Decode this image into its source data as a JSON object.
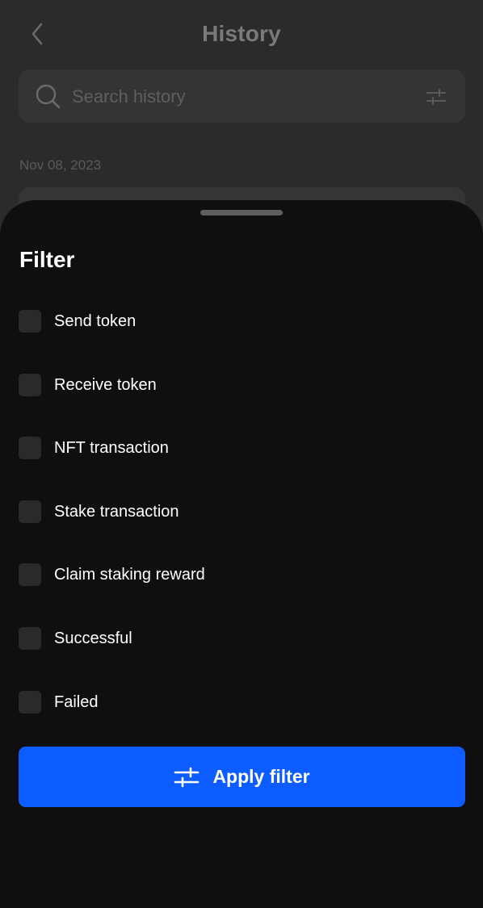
{
  "header": {
    "title": "History",
    "back_icon": "chevron-left-icon"
  },
  "search": {
    "placeholder": "Search history",
    "value": "",
    "search_icon": "search-icon",
    "filter_icon": "sliders-icon"
  },
  "history": {
    "date_group": "Nov 08, 2023"
  },
  "filter_sheet": {
    "title": "Filter",
    "options": [
      {
        "label": "Send token",
        "checked": false
      },
      {
        "label": "Receive token",
        "checked": false
      },
      {
        "label": "NFT transaction",
        "checked": false
      },
      {
        "label": "Stake transaction",
        "checked": false
      },
      {
        "label": "Claim staking reward",
        "checked": false
      },
      {
        "label": "Successful",
        "checked": false
      },
      {
        "label": "Failed",
        "checked": false
      }
    ],
    "apply_label": "Apply filter",
    "apply_icon": "sliders-icon"
  },
  "colors": {
    "accent": "#0c5cff",
    "sheet_background": "#0f0f10",
    "checkbox": "#2a2a2c"
  }
}
